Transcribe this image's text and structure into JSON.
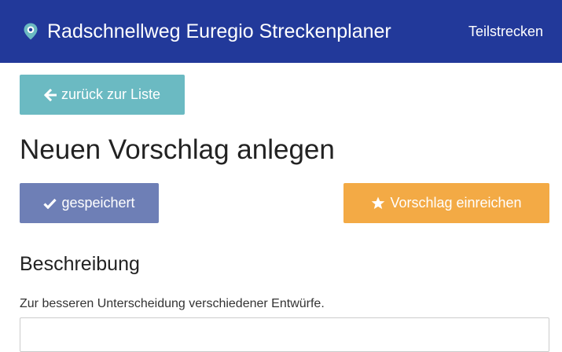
{
  "navbar": {
    "brand_icon": "map-marker-icon",
    "brand_label": "Radschnellweg Euregio Streckenplaner",
    "nav_link_label": "Teilstrecken",
    "background_color": "#22399a"
  },
  "actions": {
    "back_icon": "arrow-left-icon",
    "back_label": "zurück zur Liste",
    "back_color": "#6bbac2"
  },
  "main": {
    "page_title": "Neuen Vorschlag anlegen",
    "saved_icon": "checkmark-icon",
    "saved_label": "gespeichert",
    "saved_color": "#6e7fb6",
    "submit_icon": "star-icon",
    "submit_label": "Vorschlag einreichen",
    "submit_color": "#f3aa45"
  },
  "form": {
    "section_title": "Beschreibung",
    "help_text": "Zur besseren Unterscheidung verschiedener Entwürfe.",
    "description_value": "",
    "description_placeholder": ""
  }
}
